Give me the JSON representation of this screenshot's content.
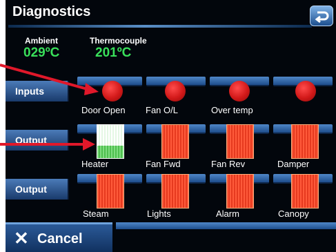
{
  "title": "Diagnostics",
  "back_icon": "return-arrow-icon",
  "readings": {
    "ambient": {
      "label": "Ambient",
      "value": "029ºC"
    },
    "thermocouple": {
      "label": "Thermocouple",
      "value": "201ºC"
    }
  },
  "rows": {
    "inputs": {
      "label": "Inputs",
      "items": [
        "Door Open",
        "Fan O/L",
        "Over temp",
        ""
      ]
    },
    "output1": {
      "label": "Output",
      "items": [
        "Heater",
        "Fan Fwd",
        "Fan Rev",
        "Damper"
      ]
    },
    "output2": {
      "label": "Output",
      "items": [
        "Steam",
        "Lights",
        "Alarm",
        "Canopy"
      ]
    }
  },
  "states": {
    "inputs": [
      "on",
      "on",
      "on",
      "on"
    ],
    "output1": [
      "on",
      "off",
      "off",
      "off"
    ],
    "output2": [
      "off",
      "off",
      "off",
      "off"
    ]
  },
  "cancel": {
    "icon": "close-icon",
    "label": "Cancel"
  },
  "colors": {
    "indicator_red": "#d21919",
    "indicator_green": "#4fbf4f",
    "reading_green": "#39e05a",
    "annotation_arrow": "#e0182a"
  }
}
